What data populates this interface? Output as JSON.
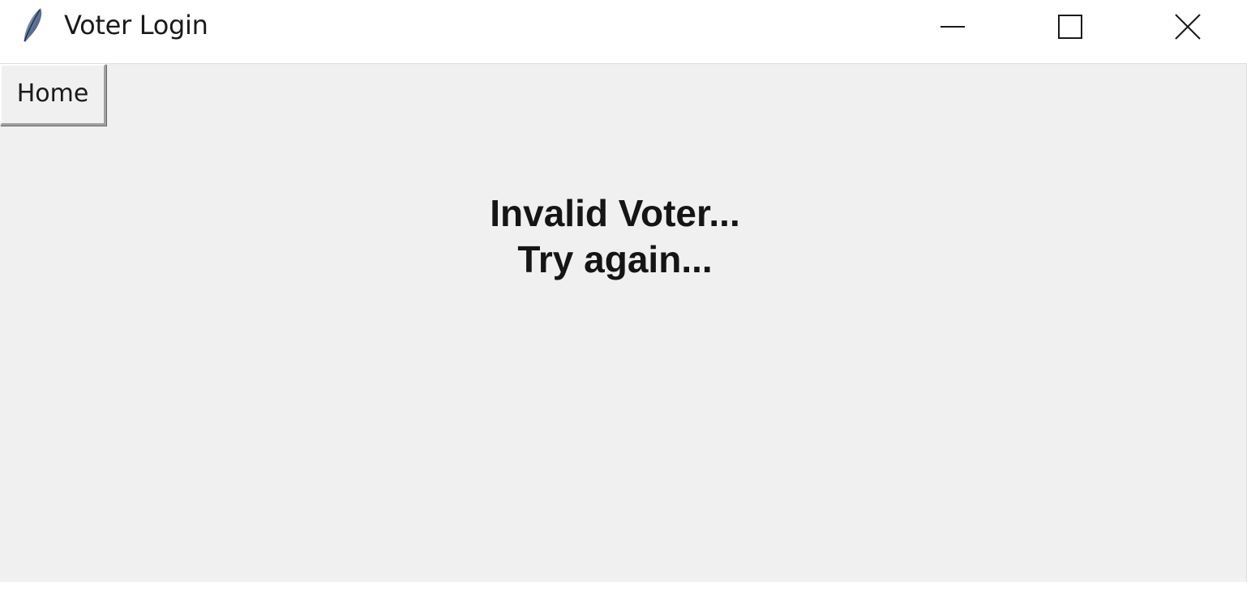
{
  "window": {
    "title": "Voter Login",
    "app_icon": "feather-icon",
    "controls": {
      "minimize_icon": "minimize-icon",
      "maximize_icon": "maximize-icon",
      "close_icon": "close-icon"
    }
  },
  "toolbar": {
    "home_label": "Home"
  },
  "message": {
    "line1": "Invalid Voter...",
    "line2": "Try again..."
  },
  "colors": {
    "client_background": "#f0f0f0",
    "titlebar_background": "#ffffff",
    "text": "#151515"
  }
}
